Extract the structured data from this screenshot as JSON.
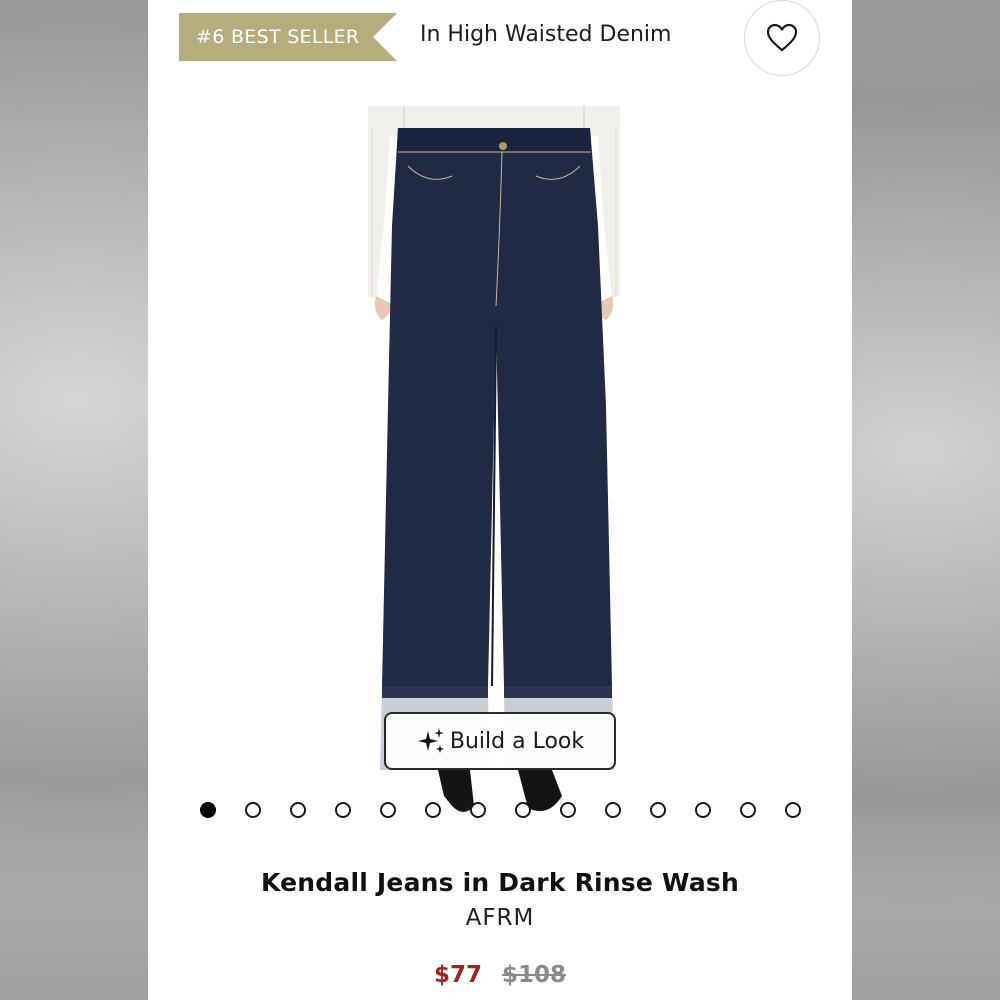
{
  "badge": {
    "label": "#6 BEST SELLER",
    "color": "#b6ad7c"
  },
  "category_link": "In High Waisted Denim",
  "favorite": {
    "icon": "heart-outline-icon"
  },
  "image": {
    "subject": "dark rinse wide-leg cuffed jeans",
    "colors": {
      "denim": "#1f2a44",
      "cuff": "#c9ced6",
      "sweater": "#f1efe9"
    }
  },
  "build_look": {
    "label": "Build a Look",
    "icon": "sparkles-icon"
  },
  "carousel": {
    "total": 14,
    "active": 0
  },
  "product": {
    "name": "Kendall Jeans in Dark Rinse Wash",
    "brand": "AFRM",
    "sale_price": "$77",
    "original_price": "$108",
    "sale_color": "#a3211d"
  }
}
